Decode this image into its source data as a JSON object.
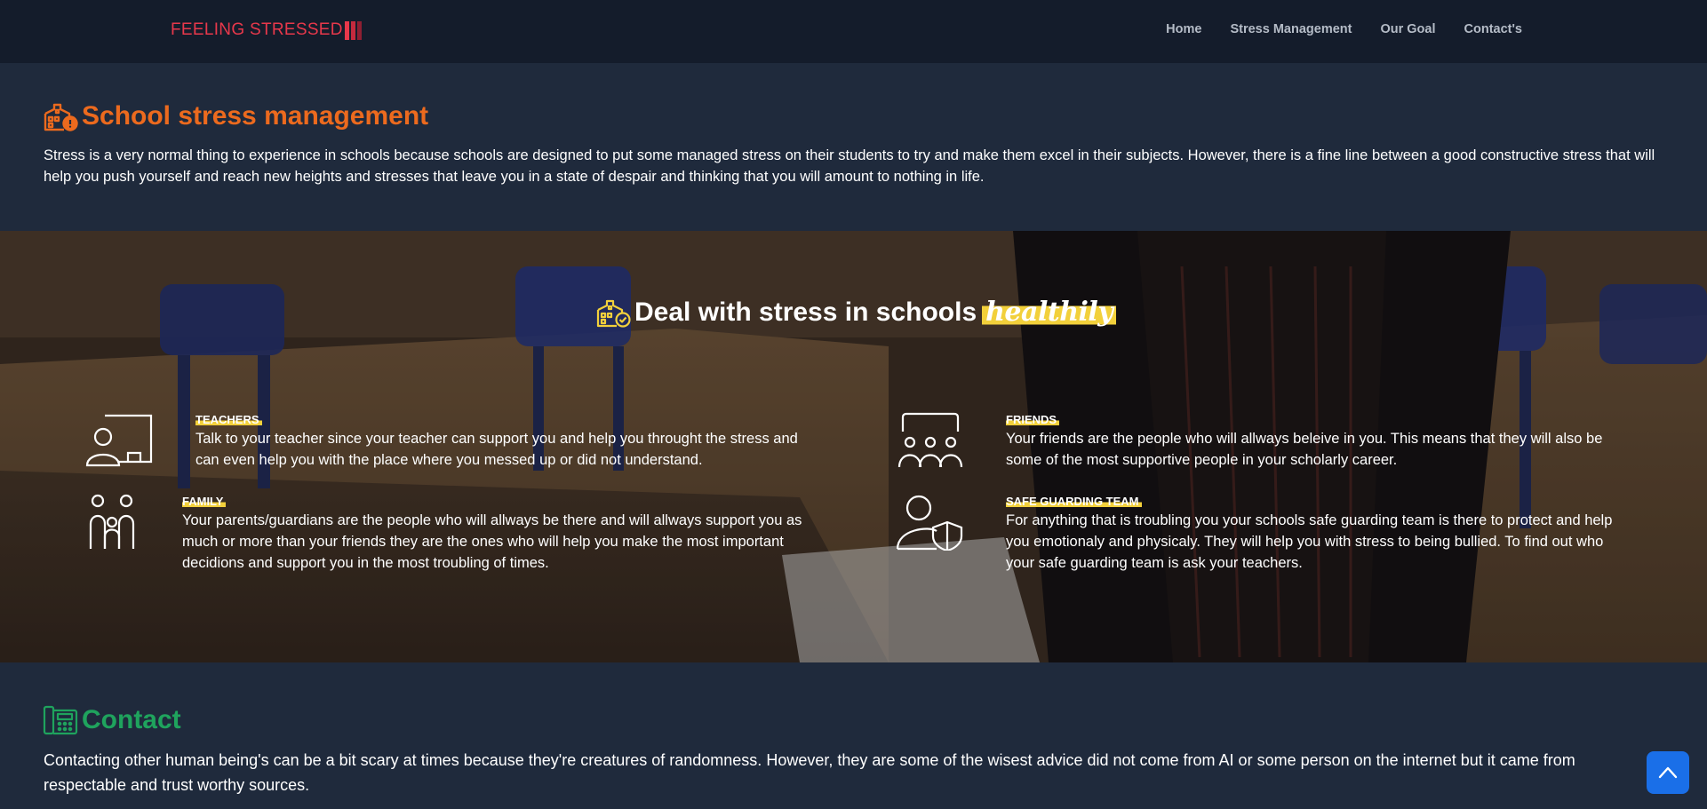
{
  "brand": {
    "name": "FEELING STRESSED",
    "color": "#e8384b",
    "bar_colors": [
      "#e8384b",
      "#c42a3e",
      "#8e1f32"
    ]
  },
  "nav": {
    "items": [
      "Home",
      "Stress Management",
      "Our Goal",
      "Contact's"
    ]
  },
  "school": {
    "icon": "school-alert-icon",
    "title": "School stress management",
    "title_color": "#ec6a1e",
    "text": "Stress is a very normal thing to experience in schools because schools are designed to put some managed stress on their students to try and make them excel in their subjects. However, there is a fine line between a good constructive stress that will help you push yourself and reach new heights and stresses that leave you in a state of despair and thinking that you will amount to nothing in life."
  },
  "deal": {
    "icon": "school-check-icon",
    "title": "Deal with stress in schools",
    "highlight": "healthily",
    "highlight_color": "#f2d03b",
    "cards": [
      {
        "icon": "teacher-board-icon",
        "title": "TEACHERS",
        "text": "Talk to your teacher since your teacher can support you and help you throught the stress and can even help you with the place where you messed up or did not understand."
      },
      {
        "icon": "friends-group-icon",
        "title": "FRIENDS",
        "text": "Your friends are the people who will allways beleive in you. This means that they will also be some of the most supportive people in your scholarly career."
      },
      {
        "icon": "family-icon",
        "title": "FAMILY",
        "text": "Your parents/guardians are the people who will allways be there and will allways support you as much or more than your friends they are the ones who will help you make the most important decidions and support you in the most troubling of times."
      },
      {
        "icon": "user-shield-icon",
        "title": "SAFE GUARDING TEAM",
        "text": "For anything that is troubling you your schools safe guarding team is there to protect and help you emotionaly and physicaly. They will help you with stress to being bullied. To find out who your safe guarding team is ask your teachers."
      }
    ]
  },
  "contact": {
    "icon": "fax-phone-icon",
    "title": "Contact",
    "title_color": "#1fa35d",
    "text": "Contacting other human being's can be a bit scary at times because they're creatures of randomness. However, they are some of the wisest advice did not come from AI or some person on the internet but it came from respectable and trust worthy sources."
  },
  "back_to_top": {
    "icon": "chevron-up-icon",
    "color": "#1a6fe8"
  }
}
